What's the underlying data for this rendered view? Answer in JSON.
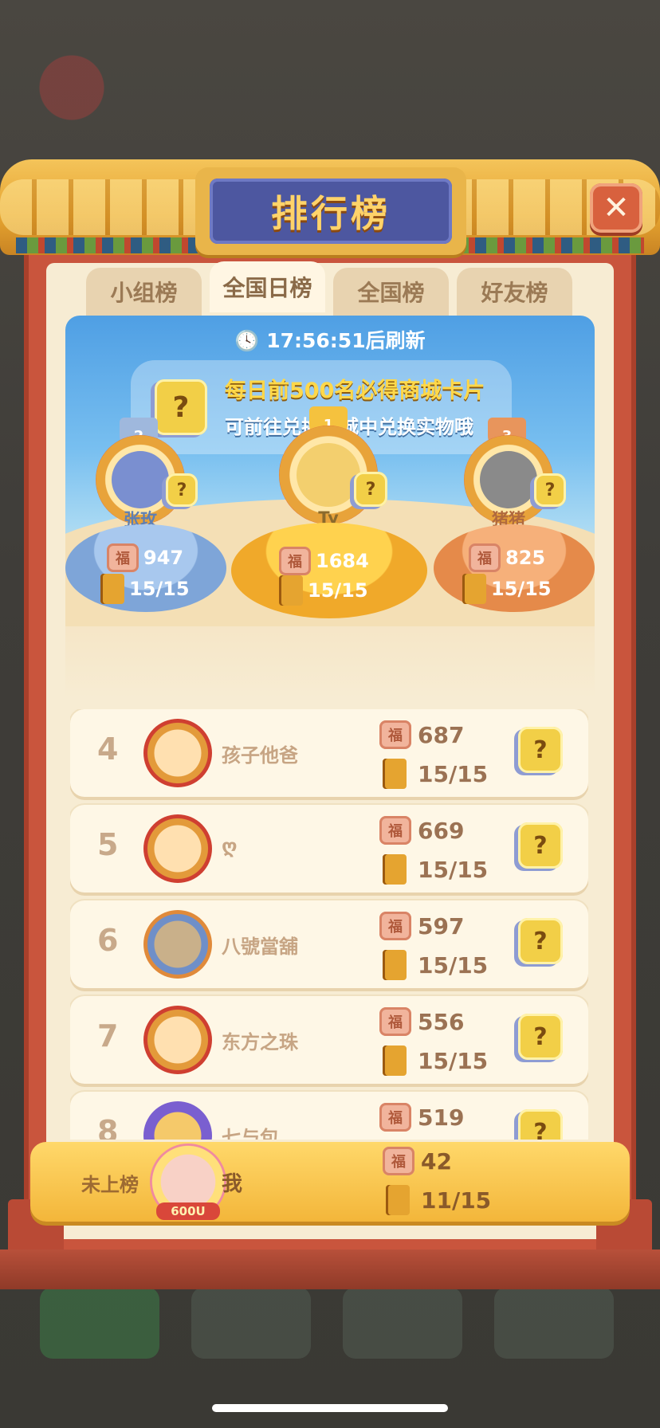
{
  "title": "排行榜",
  "close_icon": "close-icon",
  "tabs": [
    {
      "label": "小组榜",
      "active": false
    },
    {
      "label": "全国日榜",
      "active": true
    },
    {
      "label": "全国榜",
      "active": false
    },
    {
      "label": "好友榜",
      "active": false
    }
  ],
  "refresh_text": "17:56:51后刷新",
  "banner": {
    "line1": "每日前500名必得商城卡片",
    "line2": "可前往兑换商城中兑换实物哦",
    "card_glyph": "?"
  },
  "podium": [
    {
      "place": "2",
      "name": "张玫",
      "score": "947",
      "progress": "15/15"
    },
    {
      "place": "1",
      "name": "Ty",
      "score": "1684",
      "progress": "15/15"
    },
    {
      "place": "3",
      "name": "猪猪",
      "score": "825",
      "progress": "15/15"
    }
  ],
  "fu_glyph": "福",
  "card_glyph": "?",
  "rows": [
    {
      "rank": "4",
      "name": "孩子他爸",
      "score": "687",
      "progress": "15/15"
    },
    {
      "rank": "5",
      "name": "ღ",
      "score": "669",
      "progress": "15/15"
    },
    {
      "rank": "6",
      "name": "八號當舖",
      "score": "597",
      "progress": "15/15"
    },
    {
      "rank": "7",
      "name": "东方之珠",
      "score": "556",
      "progress": "15/15"
    },
    {
      "rank": "8",
      "name": "七与包",
      "score": "519",
      "progress": ""
    }
  ],
  "me": {
    "rank_text": "未上榜",
    "name": "我",
    "badge": "600U",
    "score": "42",
    "progress": "11/15"
  },
  "colors": {
    "panel_red": "#c9553d",
    "gold": "#f3b63a",
    "plaque_blue": "#4d57a0",
    "sky_blue": "#4f9fe4"
  }
}
